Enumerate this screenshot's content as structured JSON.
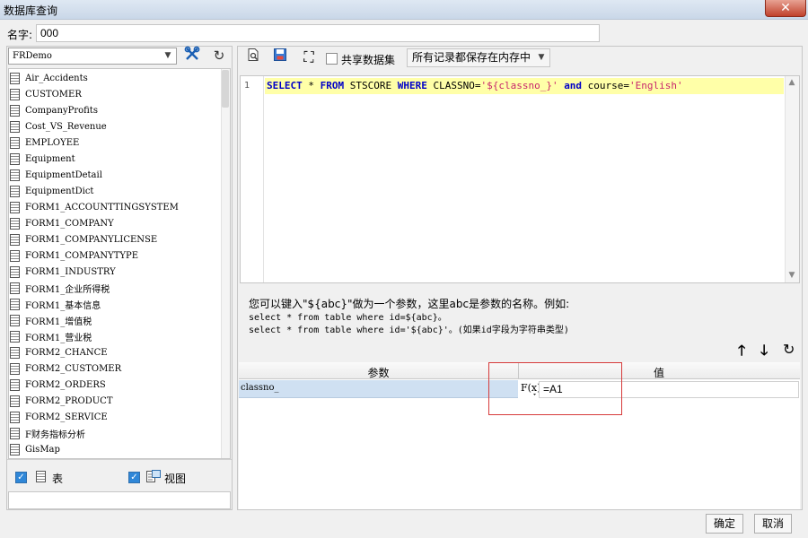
{
  "window": {
    "title": "数据库查询",
    "close_glyph": "✕"
  },
  "name_field": {
    "label": "名字:",
    "value": "000"
  },
  "left": {
    "datasource": "FRDemo",
    "items": [
      "Air_Accidents",
      "CUSTOMER",
      "CompanyProfits",
      "Cost_VS_Revenue",
      "EMPLOYEE",
      "Equipment",
      "EquipmentDetail",
      "EquipmentDict",
      "FORM1_ACCOUNTTINGSYSTEM",
      "FORM1_COMPANY",
      "FORM1_COMPANYLICENSE",
      "FORM1_COMPANYTYPE",
      "FORM1_INDUSTRY",
      "FORM1_企业所得税",
      "FORM1_基本信息",
      "FORM1_增值税",
      "FORM1_营业税",
      "FORM2_CHANCE",
      "FORM2_CUSTOMER",
      "FORM2_ORDERS",
      "FORM2_PRODUCT",
      "FORM2_SERVICE",
      "F财务指标分析",
      "GisMap"
    ],
    "table_filter_label": "表",
    "view_filter_label": "视图"
  },
  "toolbar": {
    "share_label": "共享数据集",
    "save_mode": "所有记录都保存在内存中"
  },
  "sql": {
    "line_number": "1",
    "tokens": {
      "t1": "SELECT",
      "t2": " * ",
      "t3": "FROM",
      "t4": " STSCORE ",
      "t5": "WHERE",
      "t6": " CLASSNO=",
      "t7": "'${classno_}'",
      "t8": " ",
      "t9": "and",
      "t10": " course=",
      "t11": "'English'"
    }
  },
  "hint": {
    "line1": "您可以键入\"${abc}\"做为一个参数，这里abc是参数的名称。例如:",
    "line2": "select * from table where id=${abc}。",
    "line3": "select * from table where id='${abc}'。(如果id字段为字符串类型)"
  },
  "params": {
    "col_param": "参数",
    "col_value": "值",
    "rows": [
      {
        "name": "classno_",
        "value": "=A1",
        "formula_label": "F(x)"
      }
    ]
  },
  "footer": {
    "ok": "确定",
    "cancel": "取消"
  },
  "icons": {
    "move_up": "🡑",
    "move_down": "🡓",
    "refresh": "↻",
    "expand": "⛶",
    "dropdown": "▼"
  }
}
